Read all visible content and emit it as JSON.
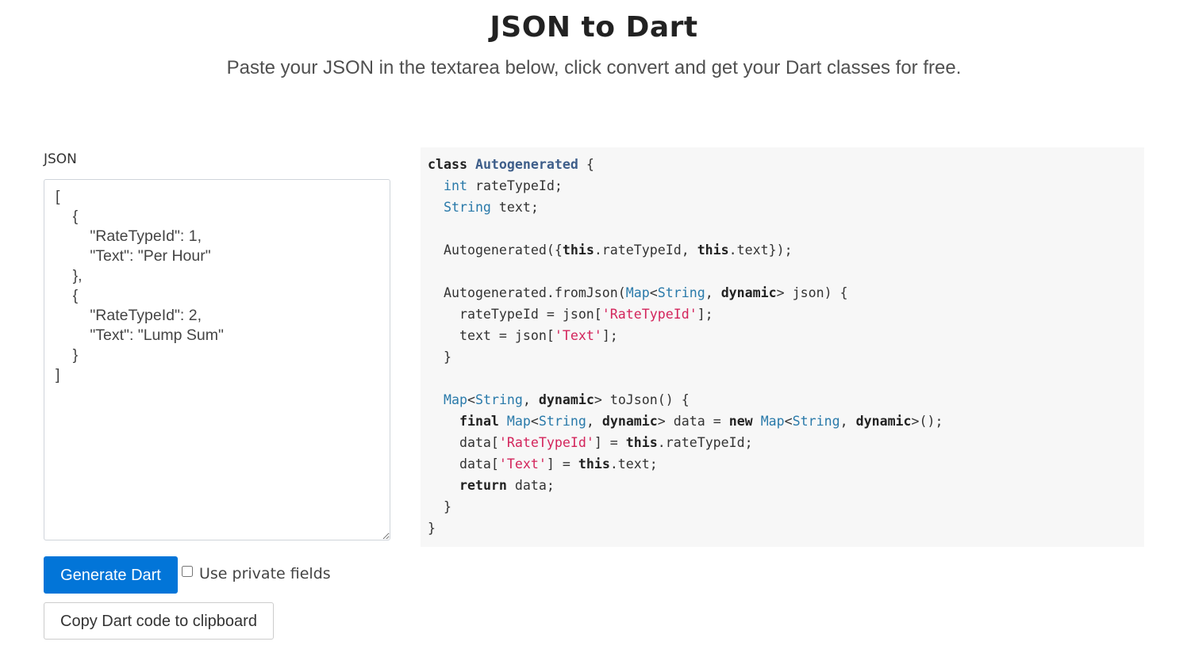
{
  "header": {
    "title": "JSON to Dart",
    "subtitle": "Paste your JSON in the textarea below, click convert and get your Dart classes for free."
  },
  "input": {
    "label": "JSON",
    "value": "[\n    {\n        \"RateTypeId\": 1,\n        \"Text\": \"Per Hour\"\n    },\n    {\n        \"RateTypeId\": 2,\n        \"Text\": \"Lump Sum\"\n    }\n]"
  },
  "actions": {
    "generate_label": "Generate Dart",
    "private_fields_label": "Use private fields",
    "private_fields_checked": false,
    "copy_label": "Copy Dart code to clipboard"
  },
  "output": {
    "lines": [
      [
        [
          "kw",
          "class"
        ],
        [
          "",
          " "
        ],
        [
          "cls",
          "Autogenerated"
        ],
        [
          "",
          " {"
        ]
      ],
      [
        [
          "",
          "  "
        ],
        [
          "ty",
          "int"
        ],
        [
          "",
          " rateTypeId;"
        ]
      ],
      [
        [
          "",
          "  "
        ],
        [
          "ty",
          "String"
        ],
        [
          "",
          " text;"
        ]
      ],
      [],
      [
        [
          "",
          "  Autogenerated({"
        ],
        [
          "kw",
          "this"
        ],
        [
          "",
          ".rateTypeId, "
        ],
        [
          "kw",
          "this"
        ],
        [
          "",
          ".text});"
        ]
      ],
      [],
      [
        [
          "",
          "  Autogenerated.fromJson("
        ],
        [
          "ty",
          "Map"
        ],
        [
          "",
          "<"
        ],
        [
          "ty",
          "String"
        ],
        [
          "",
          ", "
        ],
        [
          "kw",
          "dynamic"
        ],
        [
          "",
          "> json) {"
        ]
      ],
      [
        [
          "",
          "    rateTypeId = json["
        ],
        [
          "str",
          "'RateTypeId'"
        ],
        [
          "",
          "];"
        ]
      ],
      [
        [
          "",
          "    text = json["
        ],
        [
          "str",
          "'Text'"
        ],
        [
          "",
          "];"
        ]
      ],
      [
        [
          "",
          "  }"
        ]
      ],
      [],
      [
        [
          "",
          "  "
        ],
        [
          "ty",
          "Map"
        ],
        [
          "",
          "<"
        ],
        [
          "ty",
          "String"
        ],
        [
          "",
          ", "
        ],
        [
          "kw",
          "dynamic"
        ],
        [
          "",
          "> toJson() {"
        ]
      ],
      [
        [
          "",
          "    "
        ],
        [
          "kw",
          "final"
        ],
        [
          "",
          " "
        ],
        [
          "ty",
          "Map"
        ],
        [
          "",
          "<"
        ],
        [
          "ty",
          "String"
        ],
        [
          "",
          ", "
        ],
        [
          "kw",
          "dynamic"
        ],
        [
          "",
          "> data = "
        ],
        [
          "kw",
          "new"
        ],
        [
          "",
          " "
        ],
        [
          "ty",
          "Map"
        ],
        [
          "",
          "<"
        ],
        [
          "ty",
          "String"
        ],
        [
          "",
          ", "
        ],
        [
          "kw",
          "dynamic"
        ],
        [
          "",
          ">();"
        ]
      ],
      [
        [
          "",
          "    data["
        ],
        [
          "str",
          "'RateTypeId'"
        ],
        [
          "",
          "] = "
        ],
        [
          "kw",
          "this"
        ],
        [
          "",
          ".rateTypeId;"
        ]
      ],
      [
        [
          "",
          "    data["
        ],
        [
          "str",
          "'Text'"
        ],
        [
          "",
          "] = "
        ],
        [
          "kw",
          "this"
        ],
        [
          "",
          ".text;"
        ]
      ],
      [
        [
          "",
          "    "
        ],
        [
          "kw",
          "return"
        ],
        [
          "",
          " data;"
        ]
      ],
      [
        [
          "",
          "  }"
        ]
      ],
      [
        [
          "",
          "}"
        ]
      ]
    ]
  }
}
